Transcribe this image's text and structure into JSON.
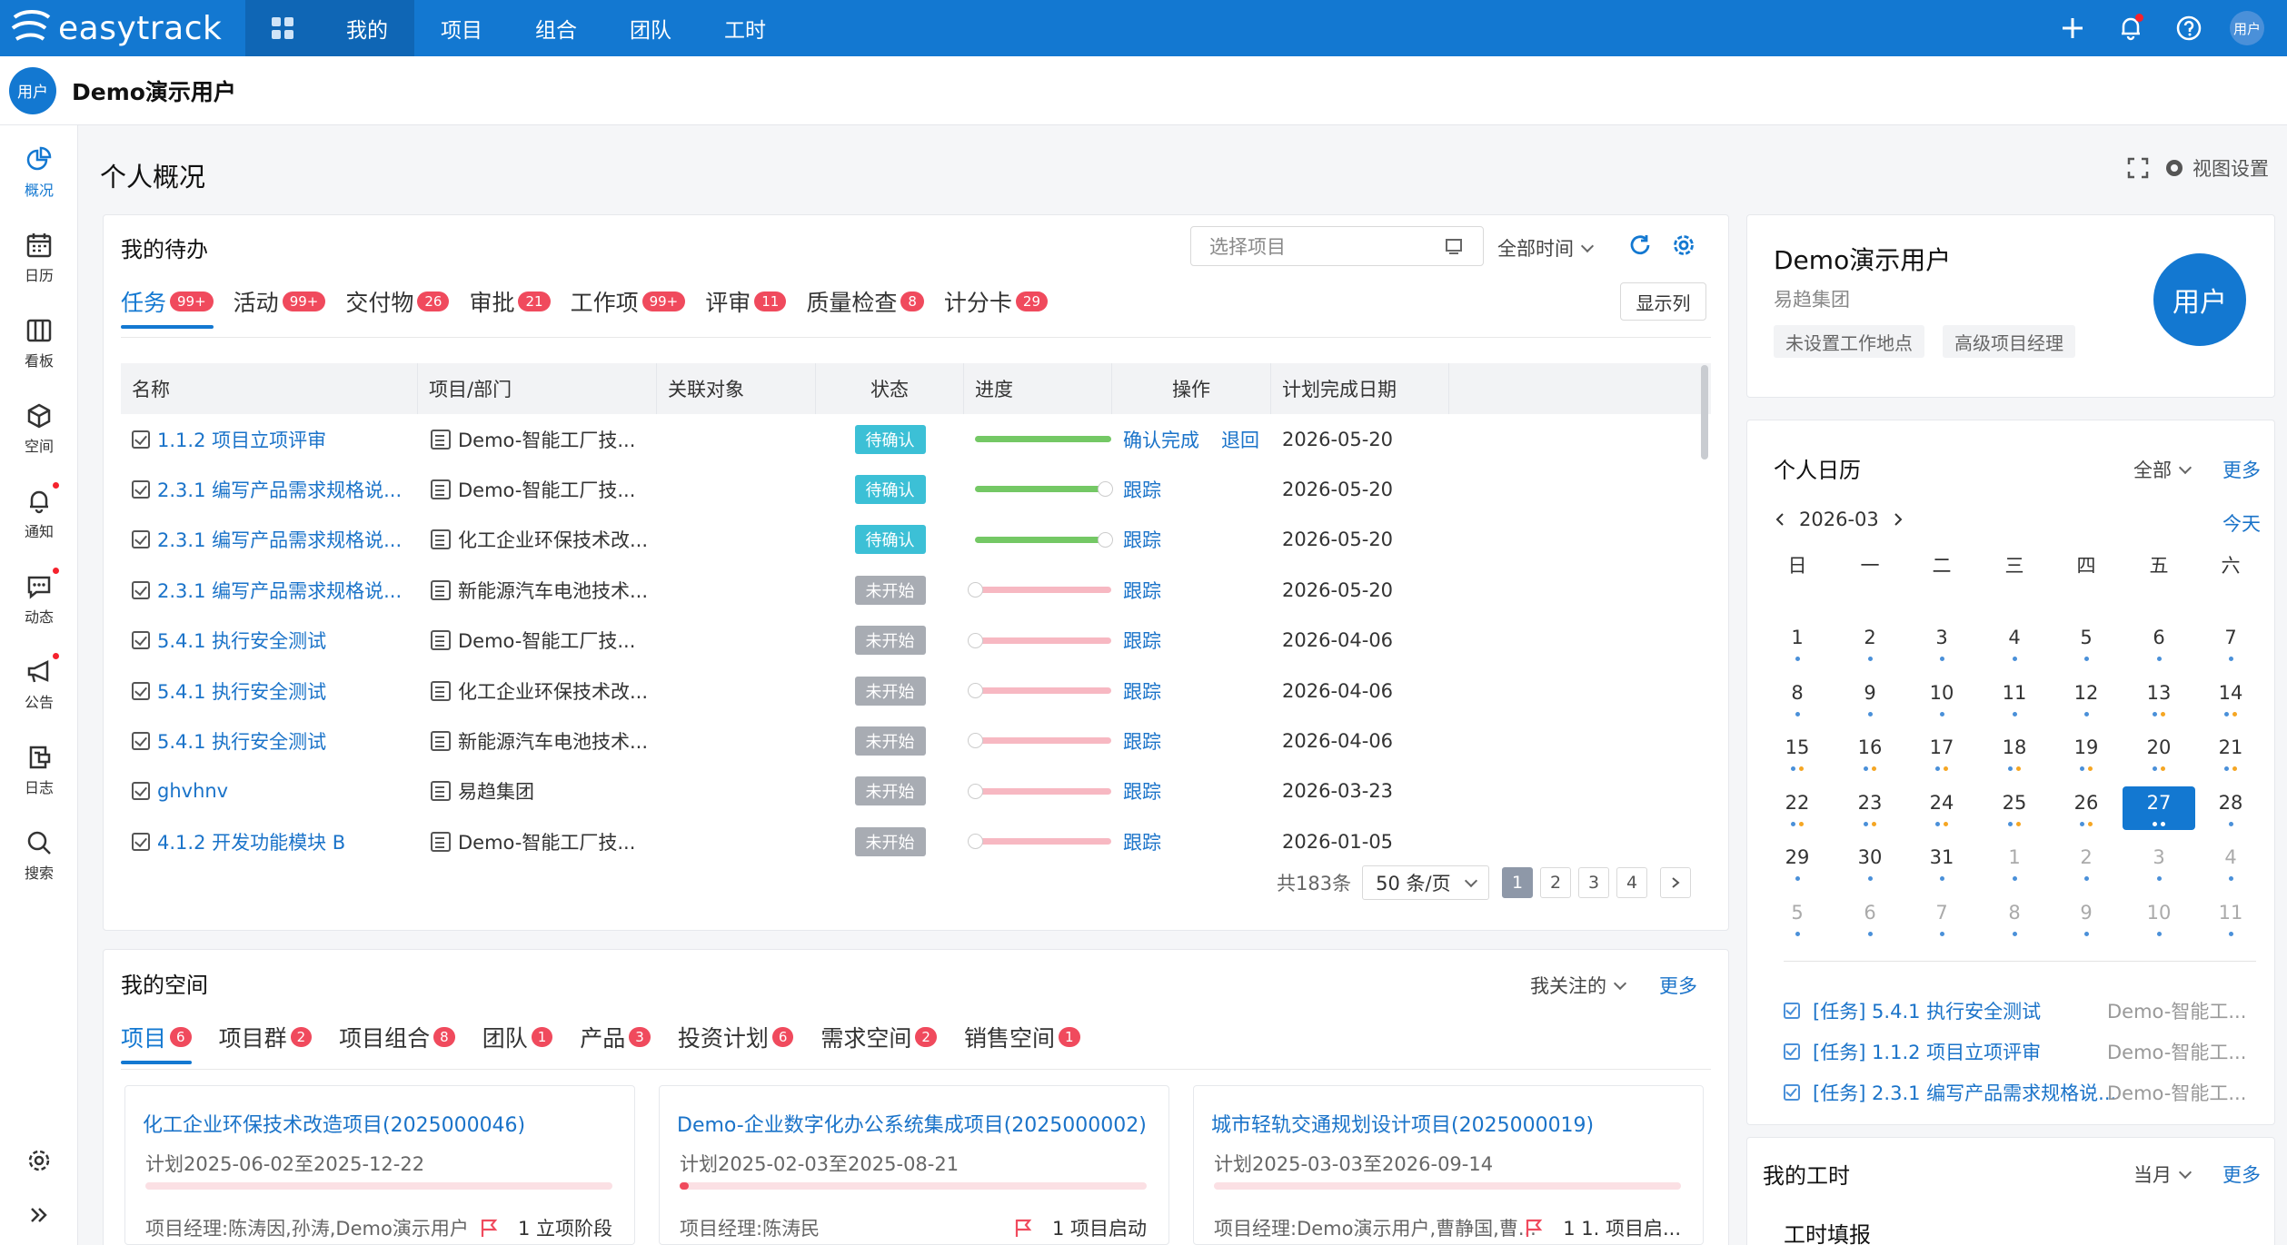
{
  "topbar": {
    "logo_text": "easytrack",
    "nav": [
      "我的",
      "项目",
      "组合",
      "团队",
      "工时"
    ],
    "avatar": "用户"
  },
  "user": {
    "avatar": "用户",
    "name": "Demo演示用户"
  },
  "sidebar": [
    {
      "label": "概况",
      "icon": "pie-chart-icon"
    },
    {
      "label": "日历",
      "icon": "calendar-icon"
    },
    {
      "label": "看板",
      "icon": "board-icon"
    },
    {
      "label": "空间",
      "icon": "cube-icon"
    },
    {
      "label": "通知",
      "icon": "bell-icon"
    },
    {
      "label": "动态",
      "icon": "chat-icon"
    },
    {
      "label": "公告",
      "icon": "megaphone-icon"
    },
    {
      "label": "日志",
      "icon": "log-icon"
    },
    {
      "label": "搜索",
      "icon": "search-icon"
    }
  ],
  "page": {
    "title": "个人概况",
    "view_settings": "视图设置"
  },
  "todo": {
    "title": "我的待办",
    "project_placeholder": "选择项目",
    "time_filter": "全部时间",
    "show_columns": "显示列",
    "tabs": [
      {
        "label": "任务",
        "count": "99+"
      },
      {
        "label": "活动",
        "count": "99+"
      },
      {
        "label": "交付物",
        "count": "26"
      },
      {
        "label": "审批",
        "count": "21"
      },
      {
        "label": "工作项",
        "count": "99+"
      },
      {
        "label": "评审",
        "count": "11"
      },
      {
        "label": "质量检查",
        "count": "8"
      },
      {
        "label": "计分卡",
        "count": "29"
      }
    ],
    "columns": [
      "名称",
      "项目/部门",
      "关联对象",
      "状态",
      "进度",
      "操作",
      "计划完成日期"
    ],
    "rows": [
      {
        "name": "1.1.2 项目立项评审",
        "project": "Demo-智能工厂技...",
        "status": "待确认",
        "progress": 1.0,
        "ops": [
          "确认完成",
          "退回"
        ],
        "date": "2026-05-20"
      },
      {
        "name": "2.3.1 编写产品需求规格说...",
        "project": "Demo-智能工厂技...",
        "status": "待确认",
        "progress": 0.95,
        "ops": [
          "跟踪"
        ],
        "date": "2026-05-20"
      },
      {
        "name": "2.3.1 编写产品需求规格说...",
        "project": "化工企业环保技术改...",
        "status": "待确认",
        "progress": 0.95,
        "ops": [
          "跟踪"
        ],
        "date": "2026-05-20"
      },
      {
        "name": "2.3.1 编写产品需求规格说...",
        "project": "新能源汽车电池技术...",
        "status": "未开始",
        "progress": 0,
        "ops": [
          "跟踪"
        ],
        "date": "2026-05-20"
      },
      {
        "name": "5.4.1 执行安全测试",
        "project": "Demo-智能工厂技...",
        "status": "未开始",
        "progress": 0,
        "ops": [
          "跟踪"
        ],
        "date": "2026-04-06"
      },
      {
        "name": "5.4.1 执行安全测试",
        "project": "化工企业环保技术改...",
        "status": "未开始",
        "progress": 0,
        "ops": [
          "跟踪"
        ],
        "date": "2026-04-06"
      },
      {
        "name": "5.4.1 执行安全测试",
        "project": "新能源汽车电池技术...",
        "status": "未开始",
        "progress": 0,
        "ops": [
          "跟踪"
        ],
        "date": "2026-04-06"
      },
      {
        "name": "ghvhnv",
        "project": "易趋集团",
        "status": "未开始",
        "progress": 0,
        "ops": [
          "跟踪"
        ],
        "date": "2026-03-23"
      },
      {
        "name": "4.1.2 开发功能模块 B",
        "project": "Demo-智能工厂技...",
        "status": "未开始",
        "progress": 0,
        "ops": [
          "跟踪"
        ],
        "date": "2026-01-05"
      }
    ],
    "total": "共183条",
    "page_size": "50 条/页",
    "pages": [
      "1",
      "2",
      "3",
      "4"
    ]
  },
  "spaces": {
    "title": "我的空间",
    "filter": "我关注的",
    "more": "更多",
    "tabs": [
      {
        "label": "项目",
        "count": "6"
      },
      {
        "label": "项目群",
        "count": "2"
      },
      {
        "label": "项目组合",
        "count": "8"
      },
      {
        "label": "团队",
        "count": "1"
      },
      {
        "label": "产品",
        "count": "3"
      },
      {
        "label": "投资计划",
        "count": "6"
      },
      {
        "label": "需求空间",
        "count": "2"
      },
      {
        "label": "销售空间",
        "count": "1"
      }
    ],
    "cards": [
      {
        "title": "化工企业环保技术改造项目(2025000046)",
        "plan": "计划2025-06-02至2025-12-22",
        "progress": 0,
        "manager": "项目经理:陈涛因,孙涛,Demo演示用户",
        "phase": "1 立项阶段"
      },
      {
        "title": "Demo-企业数字化办公系统集成项目(2025000002)",
        "plan": "计划2025-02-03至2025-08-21",
        "progress": 0.01,
        "manager": "项目经理:陈涛民",
        "phase": "1 项目启动"
      },
      {
        "title": "城市轻轨交通规划设计项目(2025000019)",
        "plan": "计划2025-03-03至2026-09-14",
        "progress": 0,
        "manager": "项目经理:Demo演示用户,曹静国,曹...",
        "phase": "1 1. 项目启..."
      }
    ]
  },
  "profile": {
    "name": "Demo演示用户",
    "org": "易趋集团",
    "tags": [
      "未设置工作地点",
      "高级项目经理"
    ],
    "avatar": "用户"
  },
  "calendar": {
    "title": "个人日历",
    "filter": "全部",
    "more": "更多",
    "month": "2026-03",
    "today_btn": "今天",
    "weekdays": [
      "日",
      "一",
      "二",
      "三",
      "四",
      "五",
      "六"
    ],
    "days": [
      [
        "1",
        "2",
        "3",
        "4",
        "5",
        "6",
        "7"
      ],
      [
        "8",
        "9",
        "10",
        "11",
        "12",
        "13",
        "14"
      ],
      [
        "15",
        "16",
        "17",
        "18",
        "19",
        "20",
        "21"
      ],
      [
        "22",
        "23",
        "24",
        "25",
        "26",
        "27",
        "28"
      ],
      [
        "29",
        "30",
        "31",
        "1",
        "2",
        "3",
        "4"
      ],
      [
        "5",
        "6",
        "7",
        "8",
        "9",
        "10",
        "11"
      ]
    ],
    "today": "27",
    "events": [
      {
        "title": "[任务] 5.4.1 执行安全测试",
        "project": "Demo-智能工..."
      },
      {
        "title": "[任务] 1.1.2 项目立项评审",
        "project": "Demo-智能工..."
      },
      {
        "title": "[任务] 2.3.1 编写产品需求规格说...",
        "project": "Demo-智能工..."
      }
    ]
  },
  "worktime": {
    "title": "我的工时",
    "filter": "当月",
    "more": "更多",
    "subtitle": "工时填报"
  },
  "colors": {
    "brand": "#1378d1",
    "badge": "#f04a5d",
    "progress_done": "#74c865",
    "progress_empty": "#f7b8c2"
  }
}
